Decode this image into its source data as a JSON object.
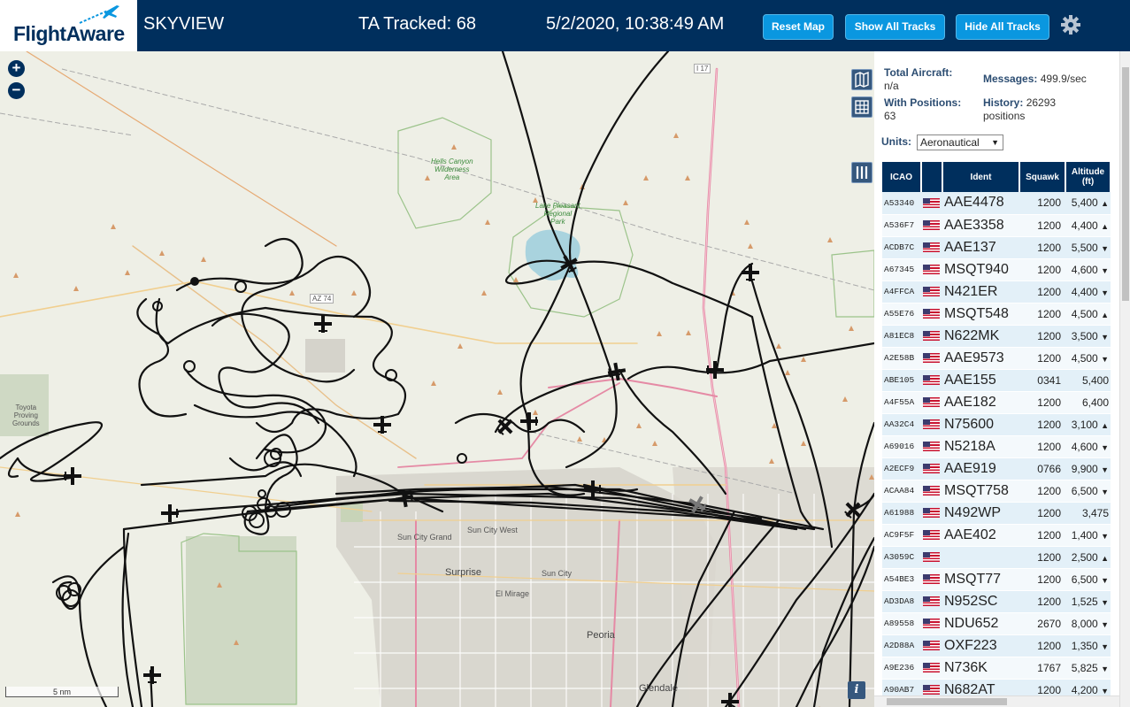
{
  "header": {
    "logo": "FlightAware",
    "title": "SKYVIEW",
    "tracked": "TA Tracked: 68",
    "datetime": "5/2/2020, 10:38:49 AM",
    "buttons": {
      "reset": "Reset Map",
      "show_all": "Show All Tracks",
      "hide_all": "Hide All Tracks"
    }
  },
  "map": {
    "zoom_in": "+",
    "zoom_out": "−",
    "scale": "5 nm",
    "labels": {
      "wilderness": [
        "Hells Canyon",
        "Wilderness",
        "Area"
      ],
      "lake": [
        "Lake Pleasant",
        "Regional",
        "Park"
      ],
      "proving": [
        "Toyota",
        "Proving",
        "Grounds"
      ],
      "sun_city_grand": "Sun City Grand",
      "sun_city_west": "Sun City West",
      "surprise": "Surprise",
      "el_mirage": "El Mirage",
      "sun_city": "Sun City",
      "peoria": "Peoria",
      "glendale": "Glendale",
      "az74": "AZ 74",
      "i17": "I 17"
    }
  },
  "sidebar": {
    "total_aircraft_label": "Total Aircraft:",
    "total_aircraft": "n/a",
    "with_positions_label": "With Positions:",
    "with_positions": "63",
    "messages_label": "Messages:",
    "messages": "499.9/sec",
    "history_label": "History:",
    "history": "26293",
    "history_unit": "positions",
    "units_label": "Units:",
    "units_value": "Aeronautical",
    "columns": [
      "ICAO",
      "",
      "Ident",
      "Squawk",
      "Altitude (ft)"
    ],
    "rows": [
      {
        "icao": "A53340",
        "ident": "AAE4478",
        "squawk": "1200",
        "alt": "5,400",
        "trend": "▲"
      },
      {
        "icao": "A536F7",
        "ident": "AAE3358",
        "squawk": "1200",
        "alt": "4,400",
        "trend": "▲"
      },
      {
        "icao": "ACDB7C",
        "ident": "AAE137",
        "squawk": "1200",
        "alt": "5,500",
        "trend": "▼"
      },
      {
        "icao": "A67345",
        "ident": "MSQT940",
        "squawk": "1200",
        "alt": "4,600",
        "trend": "▼"
      },
      {
        "icao": "A4FFCA",
        "ident": "N421ER",
        "squawk": "1200",
        "alt": "4,400",
        "trend": "▼"
      },
      {
        "icao": "A55E76",
        "ident": "MSQT548",
        "squawk": "1200",
        "alt": "4,500",
        "trend": "▲"
      },
      {
        "icao": "A81EC8",
        "ident": "N622MK",
        "squawk": "1200",
        "alt": "3,500",
        "trend": "▼"
      },
      {
        "icao": "A2E58B",
        "ident": "AAE9573",
        "squawk": "1200",
        "alt": "4,500",
        "trend": "▼"
      },
      {
        "icao": "ABE105",
        "ident": "AAE155",
        "squawk": "0341",
        "alt": "5,400",
        "trend": ""
      },
      {
        "icao": "A4F55A",
        "ident": "AAE182",
        "squawk": "1200",
        "alt": "6,400",
        "trend": ""
      },
      {
        "icao": "AA32C4",
        "ident": "N75600",
        "squawk": "1200",
        "alt": "3,100",
        "trend": "▲"
      },
      {
        "icao": "A69016",
        "ident": "N5218A",
        "squawk": "1200",
        "alt": "4,600",
        "trend": "▼"
      },
      {
        "icao": "A2ECF9",
        "ident": "AAE919",
        "squawk": "0766",
        "alt": "9,900",
        "trend": "▼"
      },
      {
        "icao": "ACAA84",
        "ident": "MSQT758",
        "squawk": "1200",
        "alt": "6,500",
        "trend": "▼"
      },
      {
        "icao": "A61988",
        "ident": "N492WP",
        "squawk": "1200",
        "alt": "3,475",
        "trend": ""
      },
      {
        "icao": "AC9F5F",
        "ident": "AAE402",
        "squawk": "1200",
        "alt": "1,400",
        "trend": "▼"
      },
      {
        "icao": "A3059C",
        "ident": "",
        "squawk": "1200",
        "alt": "2,500",
        "trend": "▲"
      },
      {
        "icao": "A54BE3",
        "ident": "MSQT77",
        "squawk": "1200",
        "alt": "6,500",
        "trend": "▼"
      },
      {
        "icao": "AD3DA8",
        "ident": "N952SC",
        "squawk": "1200",
        "alt": "1,525",
        "trend": "▼"
      },
      {
        "icao": "A89558",
        "ident": "NDU652",
        "squawk": "2670",
        "alt": "8,000",
        "trend": "▼"
      },
      {
        "icao": "A2D88A",
        "ident": "OXF223",
        "squawk": "1200",
        "alt": "1,350",
        "trend": "▼"
      },
      {
        "icao": "A9E236",
        "ident": "N736K",
        "squawk": "1767",
        "alt": "5,825",
        "trend": "▼"
      },
      {
        "icao": "A90AB7",
        "ident": "N682AT",
        "squawk": "1200",
        "alt": "4,200",
        "trend": "▼"
      }
    ]
  }
}
